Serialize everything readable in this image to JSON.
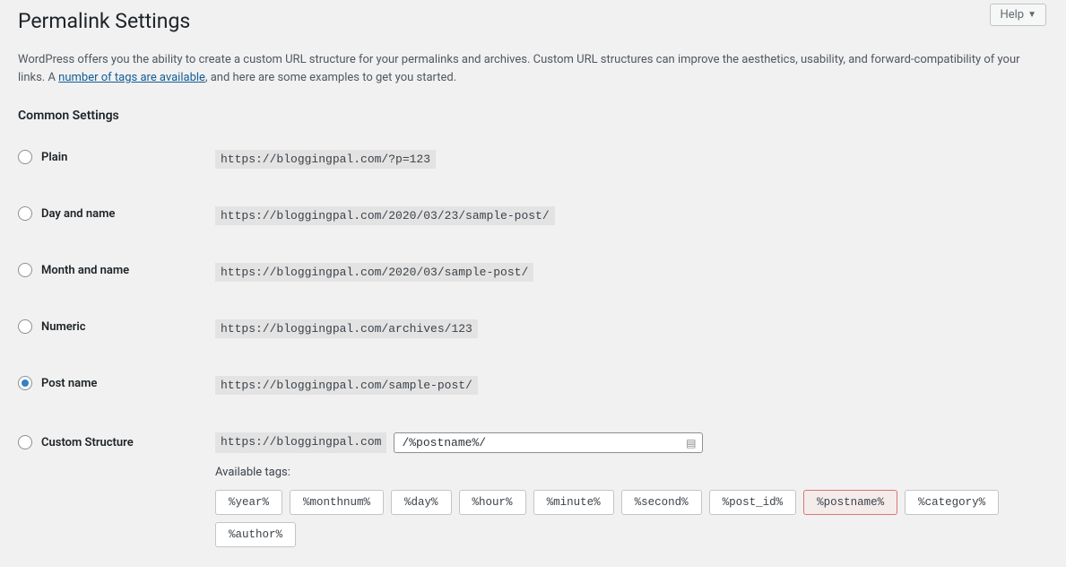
{
  "help": {
    "label": "Help"
  },
  "page": {
    "title": "Permalink Settings",
    "intro_before": "WordPress offers you the ability to create a custom URL structure for your permalinks and archives. Custom URL structures can improve the aesthetics, usability, and forward-compatibility of your links. A ",
    "intro_link": "number of tags are available",
    "intro_after": ", and here are some examples to get you started."
  },
  "common_heading": "Common Settings",
  "options": [
    {
      "label": "Plain",
      "url": "https://bloggingpal.com/?p=123",
      "checked": false
    },
    {
      "label": "Day and name",
      "url": "https://bloggingpal.com/2020/03/23/sample-post/",
      "checked": false
    },
    {
      "label": "Month and name",
      "url": "https://bloggingpal.com/2020/03/sample-post/",
      "checked": false
    },
    {
      "label": "Numeric",
      "url": "https://bloggingpal.com/archives/123",
      "checked": false
    },
    {
      "label": "Post name",
      "url": "https://bloggingpal.com/sample-post/",
      "checked": true
    }
  ],
  "custom": {
    "label": "Custom Structure",
    "base": "https://bloggingpal.com",
    "value": "/%postname%/",
    "checked": false,
    "available_label": "Available tags:",
    "tags": [
      {
        "text": "%year%",
        "active": false
      },
      {
        "text": "%monthnum%",
        "active": false
      },
      {
        "text": "%day%",
        "active": false
      },
      {
        "text": "%hour%",
        "active": false
      },
      {
        "text": "%minute%",
        "active": false
      },
      {
        "text": "%second%",
        "active": false
      },
      {
        "text": "%post_id%",
        "active": false
      },
      {
        "text": "%postname%",
        "active": true
      },
      {
        "text": "%category%",
        "active": false
      },
      {
        "text": "%author%",
        "active": false
      }
    ]
  }
}
